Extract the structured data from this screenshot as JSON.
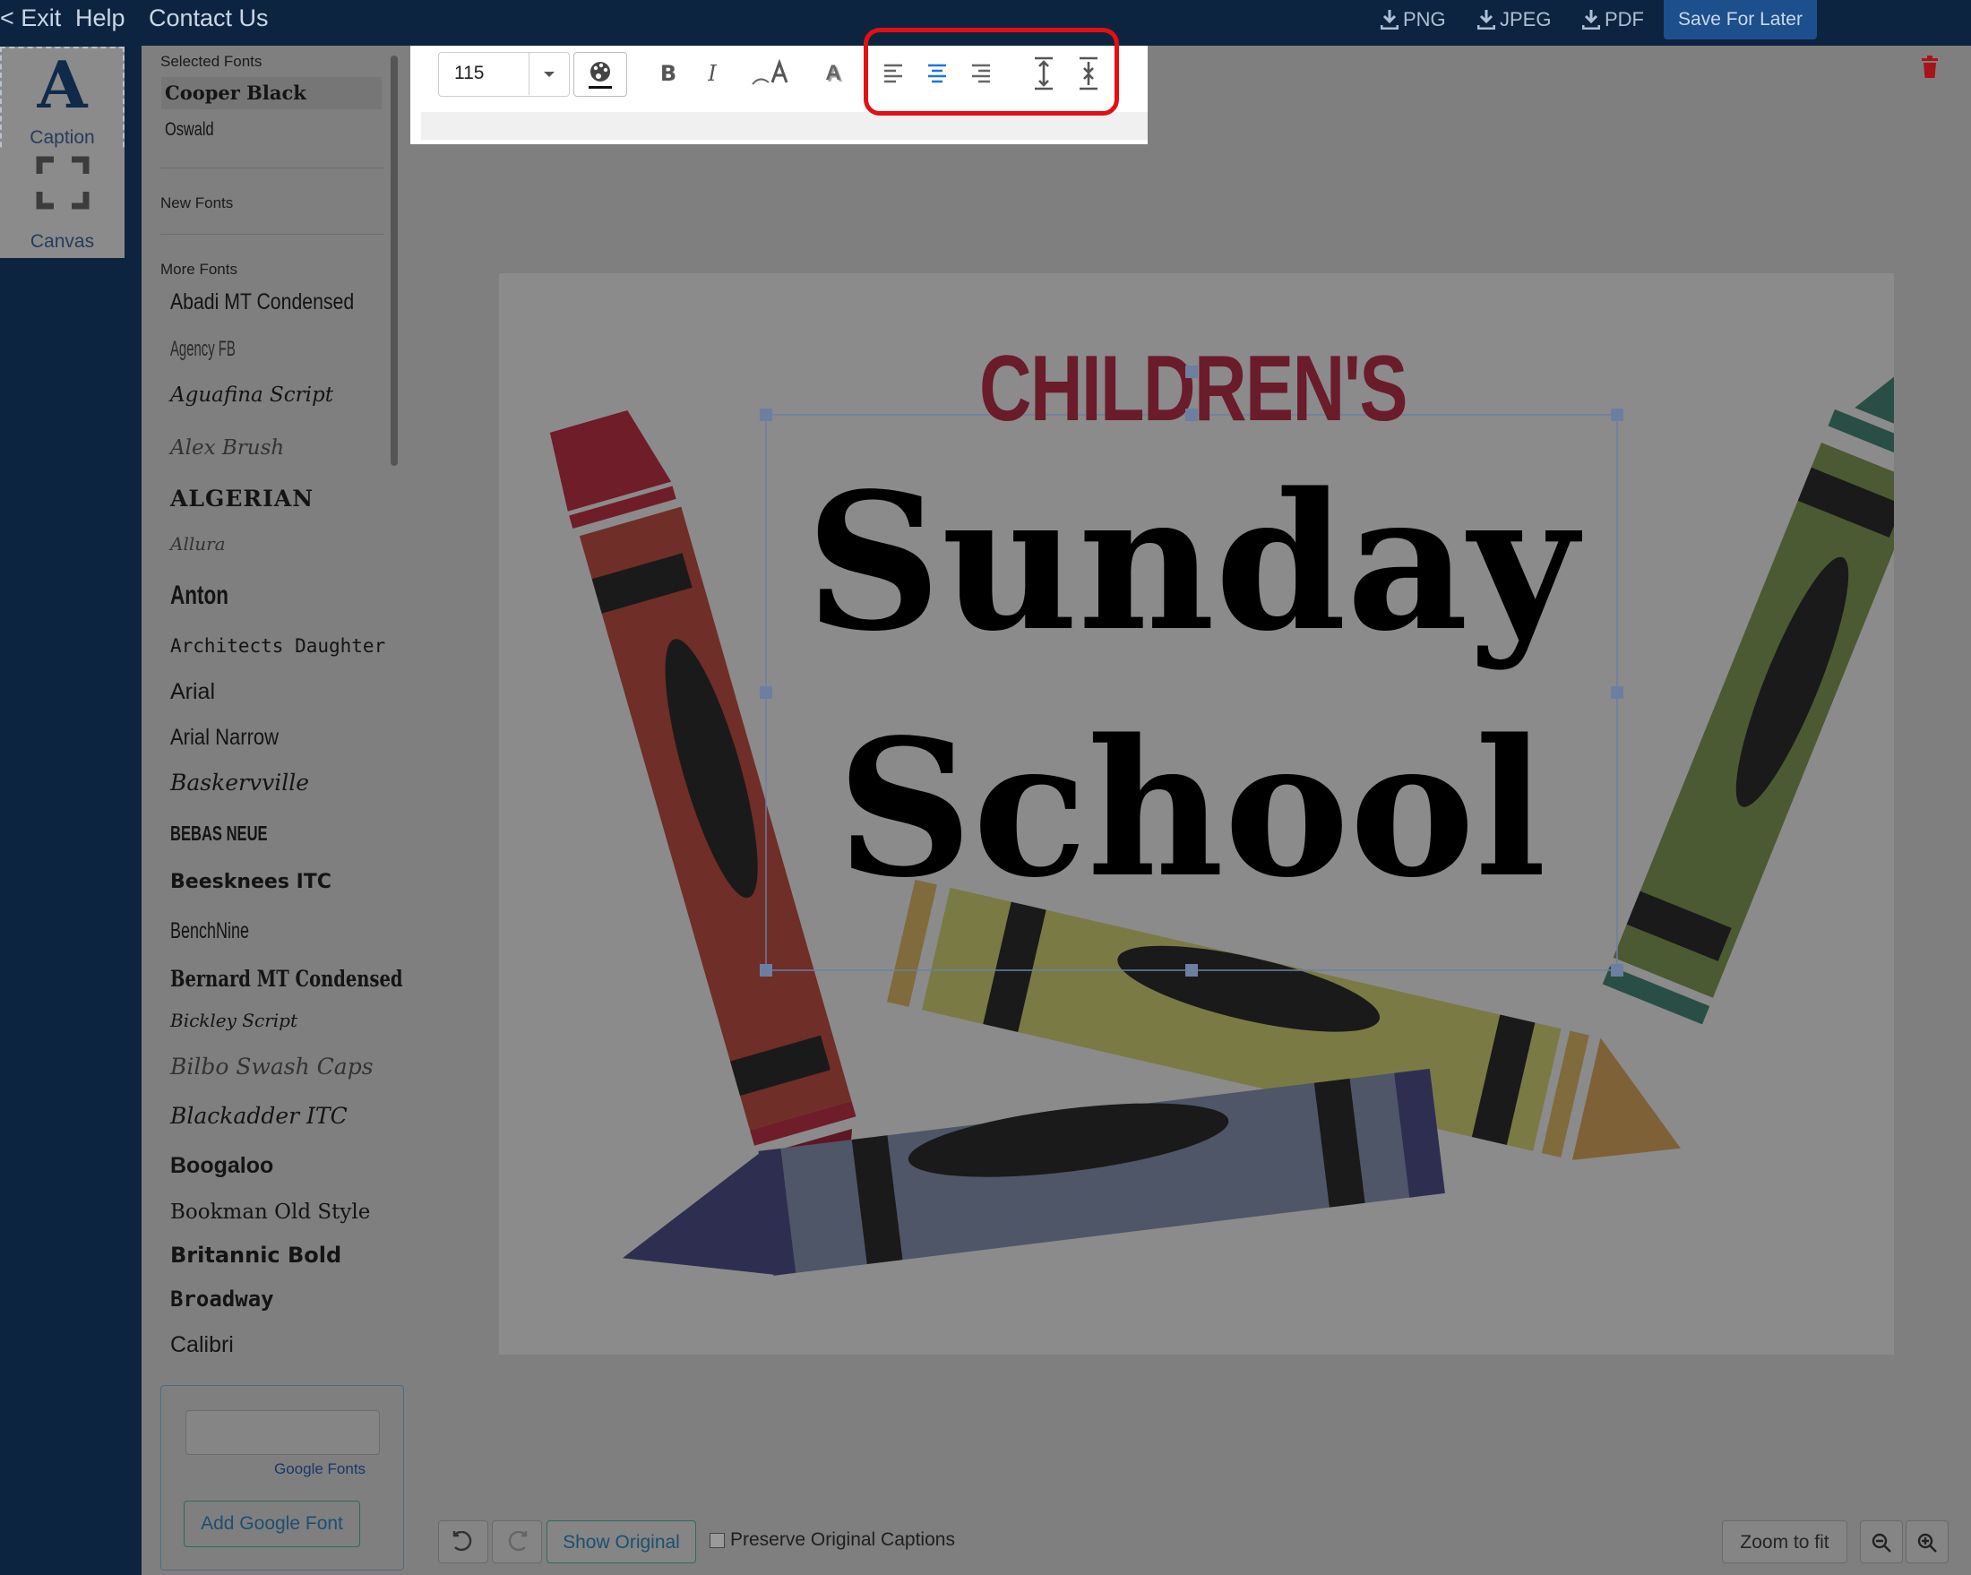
{
  "topbar": {
    "exit": "< Exit",
    "help": "Help",
    "contact": "Contact Us",
    "png": "PNG",
    "jpeg": "JPEG",
    "pdf": "PDF",
    "save": "Save For Later"
  },
  "rail": {
    "caption_glyph": "A",
    "caption": "Caption",
    "canvas": "Canvas"
  },
  "fonts": {
    "selected_header": "Selected Fonts",
    "selected": [
      "Cooper Black",
      "Oswald"
    ],
    "new_header": "New Fonts",
    "more_header": "More Fonts",
    "more": [
      "Abadi MT Condensed",
      "Agency FB",
      "Aguafina Script",
      "Alex Brush",
      "ALGERIAN",
      "Allura",
      "Anton",
      "Architects Daughter",
      "Arial",
      "Arial Narrow",
      "Baskervville",
      "BEBAS NEUE",
      "Beesknees ITC",
      "BenchNine",
      "Bernard MT Condensed",
      "Bickley Script",
      "Bilbo Swash Caps",
      "Blackadder ITC",
      "Boogaloo",
      "Bookman Old Style",
      "Britannic Bold",
      "Broadway",
      "Calibri"
    ],
    "google_link": "Google Fonts",
    "add_google": "Add Google Font"
  },
  "toolbar": {
    "font_size": "115",
    "bold": "B",
    "italic": "I",
    "outline": "A",
    "shadow": "A",
    "active_color": "#1a73e8",
    "highlight_color": "#e30f12"
  },
  "artwork": {
    "line1": "CHILDREN'S",
    "line2": "Sunday",
    "line3": "School"
  },
  "bottom": {
    "show_original": "Show Original",
    "preserve": "Preserve Original Captions",
    "zoom_fit": "Zoom to fit"
  }
}
